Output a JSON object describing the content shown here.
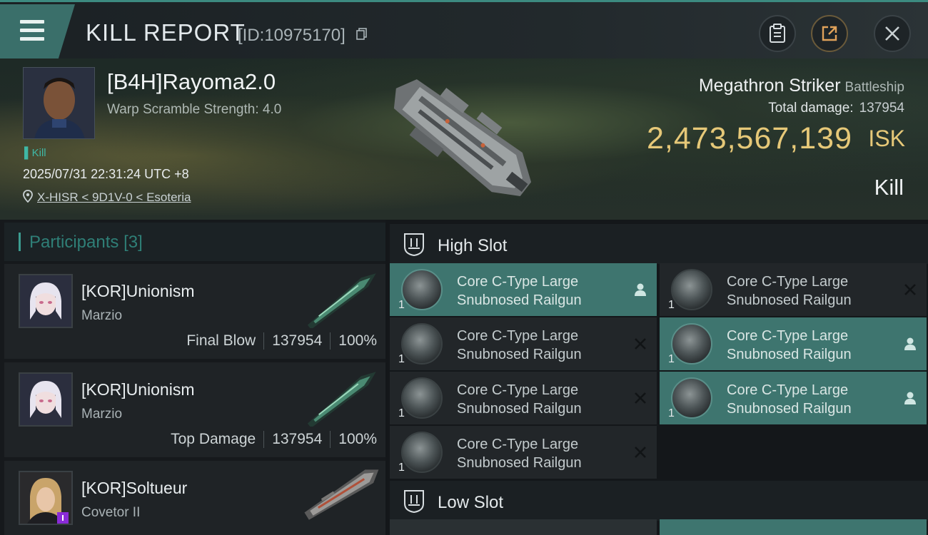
{
  "header": {
    "title": "KILL REPORT",
    "report_id": "[ID:10975170]",
    "icons": [
      "menu-icon",
      "copy-icon",
      "clipboard-icon",
      "share-icon",
      "close-icon"
    ]
  },
  "victim": {
    "name": "[B4H]Rayoma2.0",
    "warp_scramble": "Warp Scramble Strength: 4.0",
    "tag": "Kill",
    "datetime": "2025/07/31 22:31:24 UTC +8",
    "location": "X-HISR < 9D1V-0 < Esoteria",
    "ship_name": "Megathron Striker",
    "ship_class": "Battleship",
    "total_damage_label": "Total damage:",
    "total_damage": "137954",
    "isk_value": "2,473,567,139",
    "isk_unit": "ISK",
    "result": "Kill"
  },
  "participants": {
    "title": "Participants",
    "count": "[3]",
    "items": [
      {
        "name": "[KOR]Unionism",
        "ship": "Marzio",
        "label": "Final Blow",
        "damage": "137954",
        "percent": "100%"
      },
      {
        "name": "[KOR]Unionism",
        "ship": "Marzio",
        "label": "Top Damage",
        "damage": "137954",
        "percent": "100%"
      },
      {
        "name": "[KOR]Soltueur",
        "ship": "Covetor II"
      }
    ]
  },
  "high_slot": {
    "title": "High Slot",
    "modules": [
      {
        "line1": "Core C-Type Large",
        "line2": "Snubnosed Railgun",
        "qty": "1",
        "status": "pilot",
        "active": true
      },
      {
        "line1": "Core C-Type Large",
        "line2": "Snubnosed Railgun",
        "qty": "1",
        "status": "destroyed",
        "active": false
      },
      {
        "line1": "Core C-Type Large",
        "line2": "Snubnosed Railgun",
        "qty": "1",
        "status": "destroyed",
        "active": false
      },
      {
        "line1": "Core C-Type Large",
        "line2": "Snubnosed Railgun",
        "qty": "1",
        "status": "pilot",
        "active": true
      },
      {
        "line1": "Core C-Type Large",
        "line2": "Snubnosed Railgun",
        "qty": "1",
        "status": "destroyed",
        "active": false
      },
      {
        "line1": "Core C-Type Large",
        "line2": "Snubnosed Railgun",
        "qty": "1",
        "status": "pilot",
        "active": true
      },
      {
        "line1": "Core C-Type Large",
        "line2": "Snubnosed Railgun",
        "qty": "1",
        "status": "destroyed",
        "active": false
      }
    ]
  },
  "low_slot": {
    "title": "Low Slot"
  },
  "colors": {
    "accent_teal": "#3e756f",
    "isk_gold": "#e6c878",
    "panel_dark": "#1f2326"
  }
}
